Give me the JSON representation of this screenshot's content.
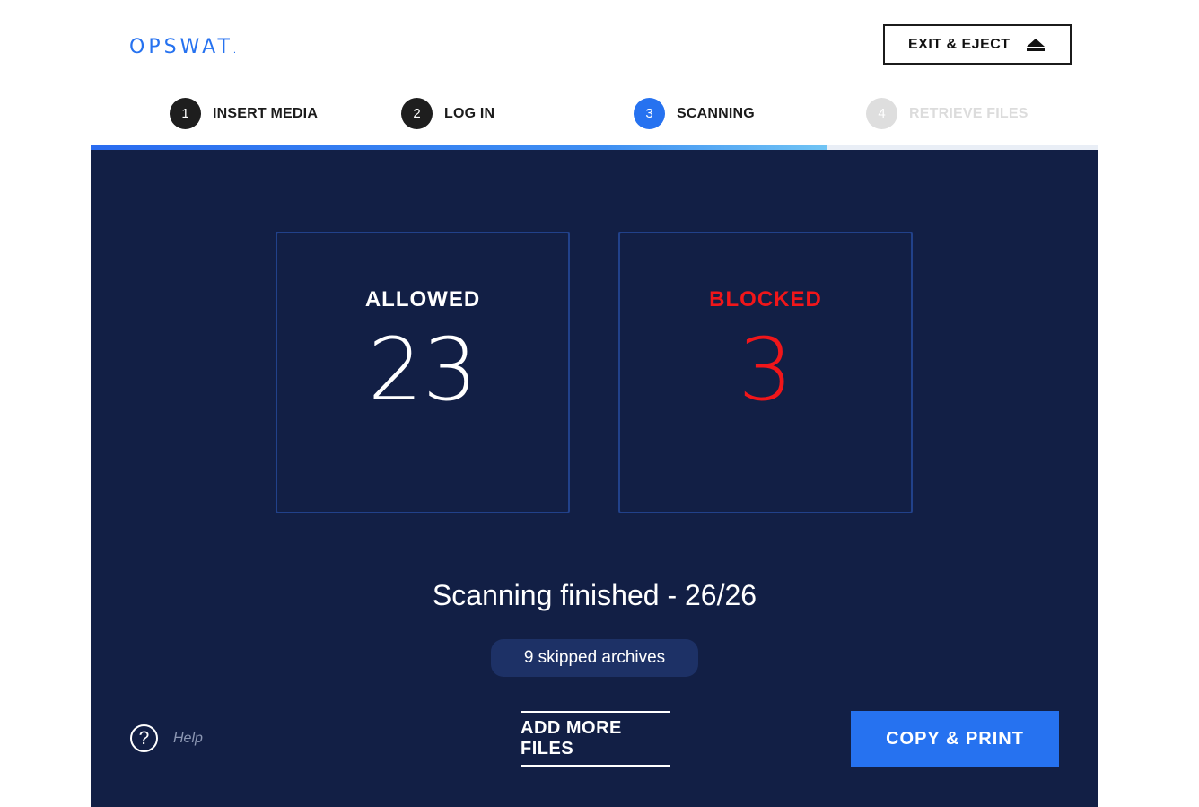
{
  "header": {
    "logo_text": "OPSWAT",
    "logo_dot": ".",
    "exit_eject_label": "EXIT & EJECT",
    "eject_icon": "eject-icon"
  },
  "steps": [
    {
      "number": "1",
      "label": "INSERT MEDIA",
      "state": "done"
    },
    {
      "number": "2",
      "label": "LOG IN",
      "state": "done"
    },
    {
      "number": "3",
      "label": "SCANNING",
      "state": "active"
    },
    {
      "number": "4",
      "label": "RETRIEVE FILES",
      "state": "disabled"
    }
  ],
  "progress": {
    "fraction": 0.73
  },
  "results": {
    "allowed": {
      "label": "ALLOWED",
      "value": "23"
    },
    "blocked": {
      "label": "BLOCKED",
      "value": "3"
    }
  },
  "status": {
    "text": "Scanning finished - 26/26",
    "skipped": "9 skipped archives"
  },
  "footer": {
    "help_icon": "question-mark-icon",
    "help_label": "Help",
    "add_files_label": "ADD MORE FILES",
    "copy_print_label": "COPY & PRINT"
  },
  "colors": {
    "accent": "#2672f0",
    "panel": "#121f45",
    "blocked": "#f0161a"
  }
}
